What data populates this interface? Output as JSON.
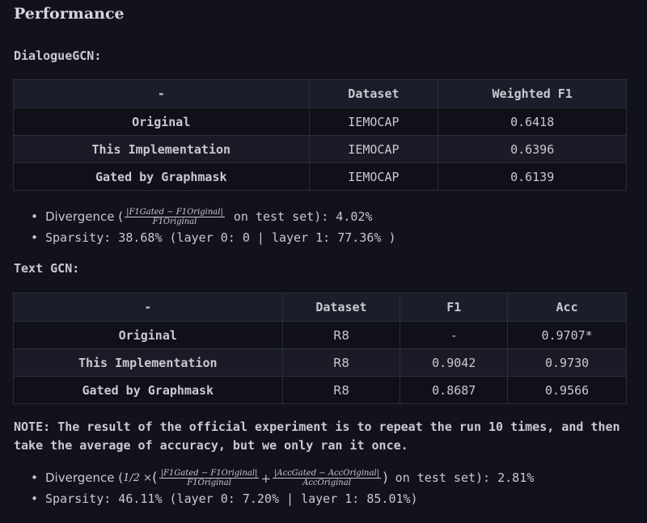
{
  "heading": "Performance",
  "dialogue": {
    "title": "DialogueGCN:",
    "headers": [
      "-",
      "Dataset",
      "Weighted F1"
    ],
    "rows": [
      [
        "Original",
        "IEMOCAP",
        "0.6418"
      ],
      [
        "This Implementation",
        "IEMOCAP",
        "0.6396"
      ],
      [
        "Gated by Graphmask",
        "IEMOCAP",
        "0.6139"
      ]
    ],
    "divergence_label": "Divergence (",
    "divergence_num": "|F1Gated − F1Original|",
    "divergence_den": "F1Original",
    "divergence_tail": " on test set): 4.02%",
    "sparsity": "Sparsity: 38.68% (layer 0: 0 | layer 1: 77.36% )"
  },
  "textgcn": {
    "title": "Text GCN:",
    "headers": [
      "-",
      "Dataset",
      "F1",
      "Acc"
    ],
    "rows": [
      [
        "Original",
        "R8",
        "-",
        "0.9707*"
      ],
      [
        "This Implementation",
        "R8",
        "0.9042",
        "0.9730"
      ],
      [
        "Gated by Graphmask",
        "R8",
        "0.8687",
        "0.9566"
      ]
    ],
    "note": "NOTE: The result of the official experiment is to repeat the run 10 times, and then take the average of accuracy, but we only ran it once.",
    "divergence_label": "Divergence (",
    "divergence_half": "1/2 ×",
    "divergence_num1": "|F1Gated − F1Original|",
    "divergence_den1": "F1Original",
    "divergence_num2": "|AccGated − AccOriginal|",
    "divergence_den2": "AccOriginal",
    "divergence_tail": " on test set): 2.81%",
    "sparsity": "Sparsity: 46.11% (layer 0: 7.20% | layer 1: 85.01%)"
  }
}
